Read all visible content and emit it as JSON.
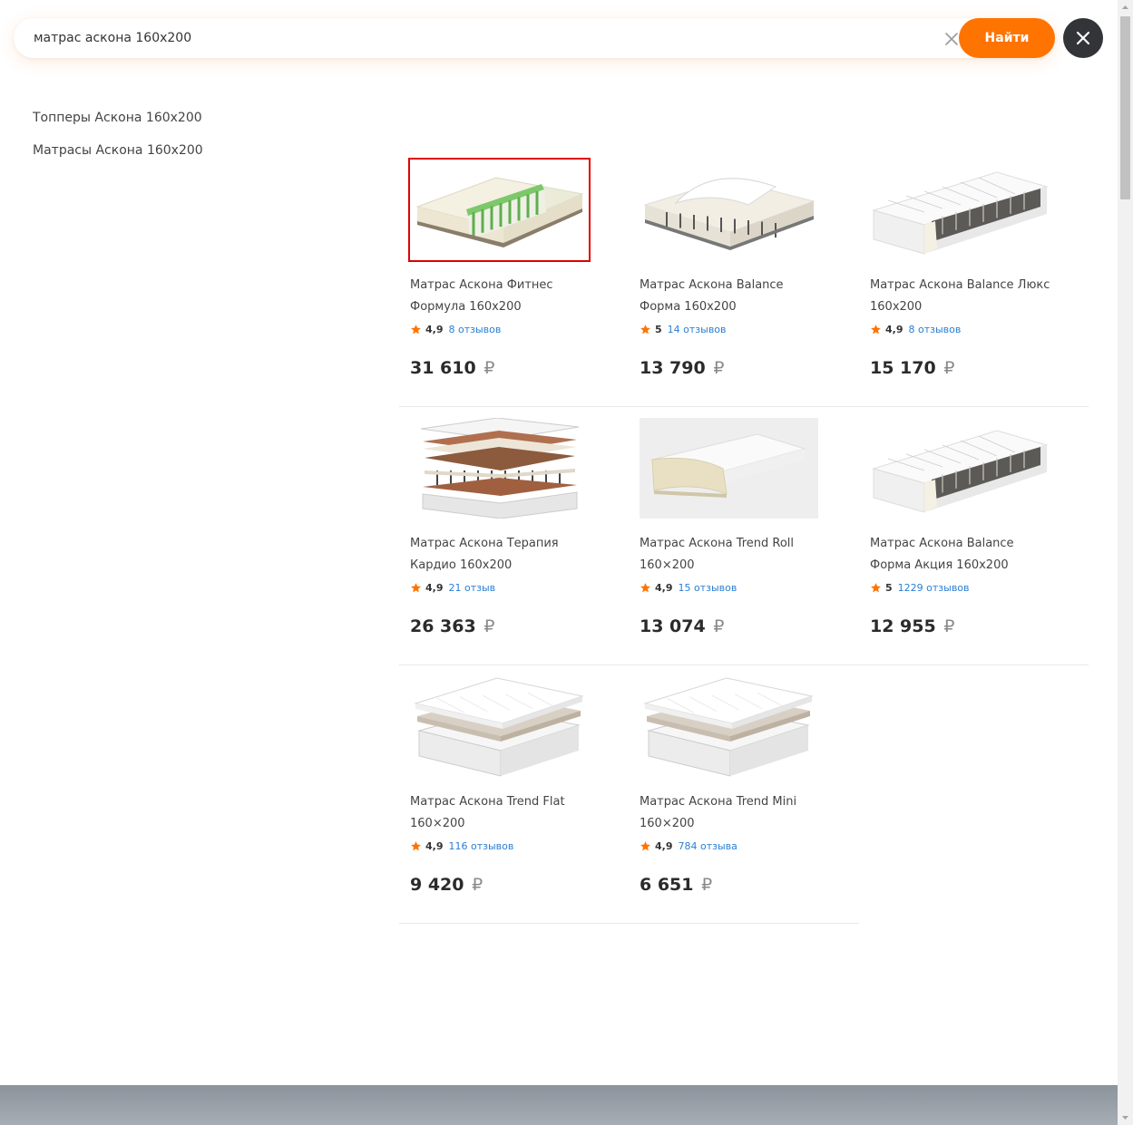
{
  "search": {
    "value": "матрас аскона 160х200",
    "button_label": "Найти"
  },
  "suggestions": [
    "Топперы Аскона 160х200",
    "Матрасы Аскона 160х200"
  ],
  "currency_symbol": "₽",
  "colors": {
    "accent": "#ff7300",
    "link": "#2a7fd4",
    "star": "#ff7300",
    "selected_outline": "#e00000"
  },
  "products": [
    {
      "name": "Матрас Аскона Фитнес Формула 160х200",
      "rating": "4,9",
      "reviews": "8 отзывов",
      "price": "31 610",
      "image_icon": "mattress-layers-green-icon",
      "selected": true
    },
    {
      "name": "Матрас Аскона Balance Форма 160х200",
      "rating": "5",
      "reviews": "14 отзывов",
      "price": "13 790",
      "image_icon": "mattress-open-cover-icon",
      "selected": false
    },
    {
      "name": "Матрас Аскона Balance Люкс 160х200",
      "rating": "4,9",
      "reviews": "8 отзывов",
      "price": "15 170",
      "image_icon": "mattress-springs-icon",
      "selected": false
    },
    {
      "name": "Матрас Аскона Терапия Кардио 160х200",
      "rating": "4,9",
      "reviews": "21 отзыв",
      "price": "26 363",
      "image_icon": "mattress-exploded-layers-icon",
      "selected": false
    },
    {
      "name": "Матрас Аскона Trend Roll 160×200",
      "rating": "4,9",
      "reviews": "15 отзывов",
      "price": "13 074",
      "image_icon": "mattress-foam-cut-icon",
      "selected": false
    },
    {
      "name": "Матрас Аскона Balance Форма Акция 160х200",
      "rating": "5",
      "reviews": "1229 отзывов",
      "price": "12 955",
      "image_icon": "mattress-springs-icon",
      "selected": false
    },
    {
      "name": "Матрас Аскона Trend Flat 160×200",
      "rating": "4,9",
      "reviews": "116 отзывов",
      "price": "9 420",
      "image_icon": "mattress-stack-icon",
      "selected": false
    },
    {
      "name": "Матрас Аскона Trend Mini 160×200",
      "rating": "4,9",
      "reviews": "784 отзыва",
      "price": "6 651",
      "image_icon": "mattress-stack-icon",
      "selected": false
    }
  ]
}
